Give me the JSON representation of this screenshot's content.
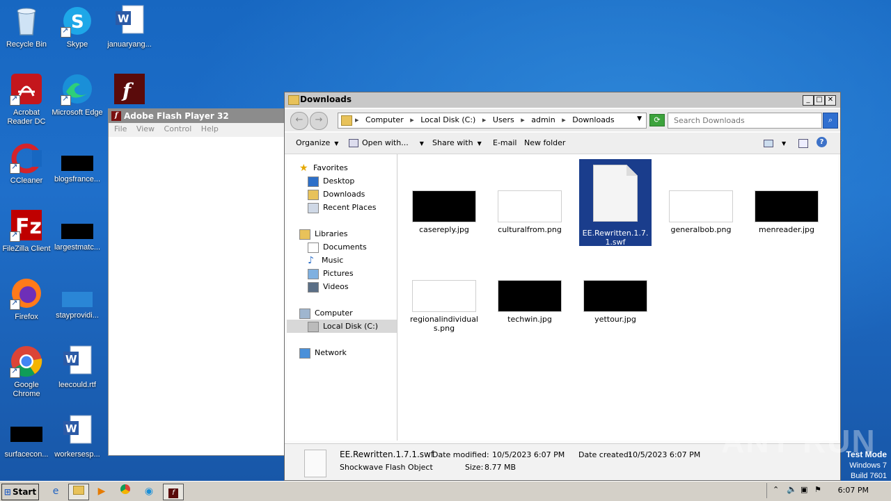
{
  "desktop": {
    "icons": [
      {
        "label": "Recycle Bin"
      },
      {
        "label": "Skype"
      },
      {
        "label": "januaryang..."
      },
      {
        "label": "Acrobat Reader DC"
      },
      {
        "label": "Microsoft Edge"
      },
      {
        "label": "CCleaner"
      },
      {
        "label": "blogsfrance..."
      },
      {
        "label": "FileZilla Client"
      },
      {
        "label": "largestmatc..."
      },
      {
        "label": "Firefox"
      },
      {
        "label": "stayprovidi..."
      },
      {
        "label": "Google Chrome"
      },
      {
        "label": "leecould.rtf"
      },
      {
        "label": "surfacecon..."
      },
      {
        "label": "workersesp..."
      }
    ]
  },
  "flash_window": {
    "title": "Adobe Flash Player 32",
    "menu": [
      "File",
      "View",
      "Control",
      "Help"
    ]
  },
  "explorer": {
    "title": "Downloads",
    "breadcrumbs": [
      "Computer",
      "Local Disk (C:)",
      "Users",
      "admin",
      "Downloads"
    ],
    "search_placeholder": "Search Downloads",
    "toolbar": {
      "organize": "Organize",
      "open_with": "Open with...",
      "share_with": "Share with",
      "email": "E-mail",
      "new_folder": "New folder"
    },
    "nav": {
      "favorites": "Favorites",
      "desktop": "Desktop",
      "downloads": "Downloads",
      "recent_places": "Recent Places",
      "libraries": "Libraries",
      "documents": "Documents",
      "music": "Music",
      "pictures": "Pictures",
      "videos": "Videos",
      "computer": "Computer",
      "local_disk": "Local Disk (C:)",
      "network": "Network"
    },
    "files": [
      {
        "name": "casereply.jpg"
      },
      {
        "name": "culturalfrom.png"
      },
      {
        "name": "EE.Rewritten.1.7.1.swf"
      },
      {
        "name": "generalbob.png"
      },
      {
        "name": "menreader.jpg"
      },
      {
        "name": "regionalindividuals.png"
      },
      {
        "name": "techwin.jpg"
      },
      {
        "name": "yettour.jpg"
      }
    ],
    "details": {
      "filename": "EE.Rewritten.1.7.1.swf",
      "filetype": "Shockwave Flash Object",
      "date_modified_label": "Date modified:",
      "date_modified": "10/5/2023 6:07 PM",
      "size_label": "Size:",
      "size": "8.77 MB",
      "date_created_label": "Date created:",
      "date_created": "10/5/2023 6:07 PM"
    }
  },
  "watermark": "ANY RUN",
  "test_mode": {
    "line1": "Test Mode",
    "line2": "Windows 7",
    "line3": "Build 7601"
  },
  "taskbar": {
    "start": "Start",
    "clock": "6:07 PM"
  }
}
